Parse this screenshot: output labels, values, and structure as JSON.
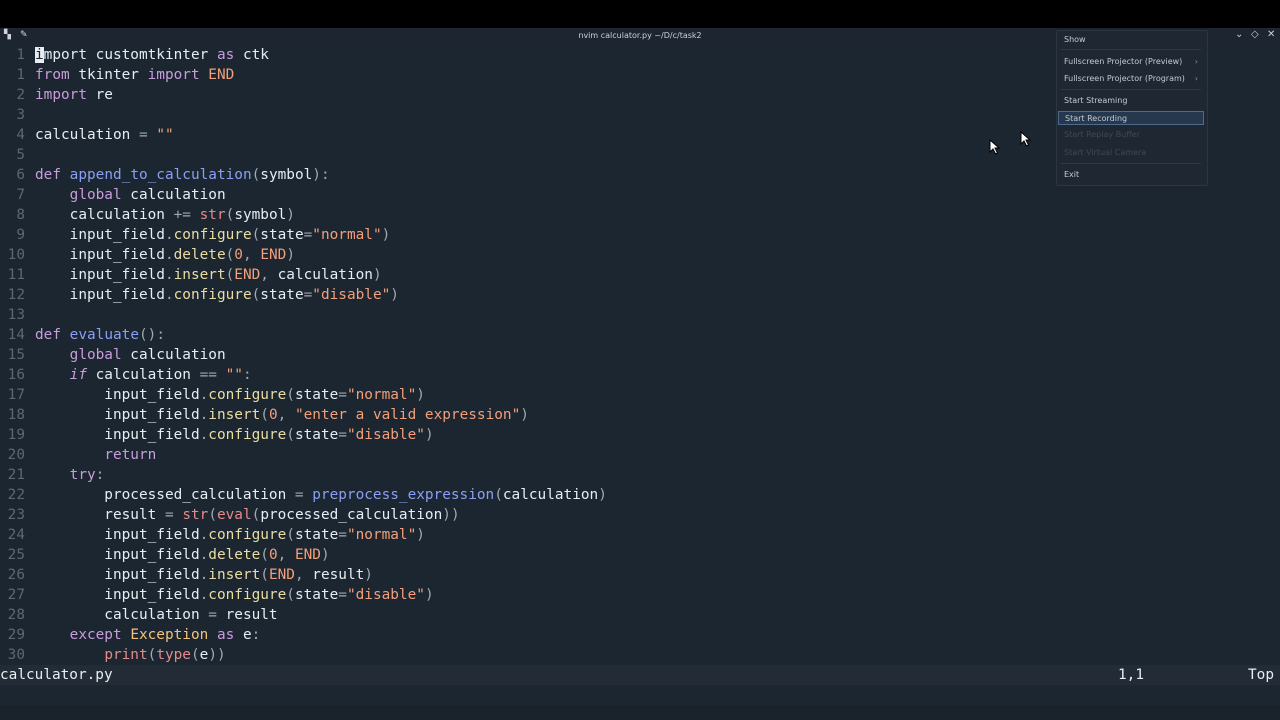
{
  "window": {
    "title": "nvim calculator.py ~/D/c/task2",
    "app_icon": "nvim-icon",
    "pin_icon": "pin-icon",
    "buttons": {
      "minimize": "⌄",
      "maximize": "◇",
      "close": "✕"
    }
  },
  "editor": {
    "lines": [
      {
        "ln": "1",
        "code": "import customtkinter as ctk"
      },
      {
        "ln": "1",
        "code": "from tkinter import END"
      },
      {
        "ln": "2",
        "code": "import re"
      },
      {
        "ln": "3",
        "code": ""
      },
      {
        "ln": "4",
        "code": "calculation = \"\""
      },
      {
        "ln": "5",
        "code": ""
      },
      {
        "ln": "6",
        "code": "def append_to_calculation(symbol):"
      },
      {
        "ln": "7",
        "code": "    global calculation"
      },
      {
        "ln": "8",
        "code": "    calculation += str(symbol)"
      },
      {
        "ln": "9",
        "code": "    input_field.configure(state=\"normal\")"
      },
      {
        "ln": "10",
        "code": "    input_field.delete(0, END)"
      },
      {
        "ln": "11",
        "code": "    input_field.insert(END, calculation)"
      },
      {
        "ln": "12",
        "code": "    input_field.configure(state=\"disable\")"
      },
      {
        "ln": "13",
        "code": ""
      },
      {
        "ln": "14",
        "code": "def evaluate():"
      },
      {
        "ln": "15",
        "code": "    global calculation"
      },
      {
        "ln": "16",
        "code": "    if calculation == \"\":"
      },
      {
        "ln": "17",
        "code": "        input_field.configure(state=\"normal\")"
      },
      {
        "ln": "18",
        "code": "        input_field.insert(0, \"enter a valid expression\")"
      },
      {
        "ln": "19",
        "code": "        input_field.configure(state=\"disable\")"
      },
      {
        "ln": "20",
        "code": "        return"
      },
      {
        "ln": "21",
        "code": "    try:"
      },
      {
        "ln": "22",
        "code": "        processed_calculation = preprocess_expression(calculation)"
      },
      {
        "ln": "23",
        "code": "        result = str(eval(processed_calculation))"
      },
      {
        "ln": "24",
        "code": "        input_field.configure(state=\"normal\")"
      },
      {
        "ln": "25",
        "code": "        input_field.delete(0, END)"
      },
      {
        "ln": "26",
        "code": "        input_field.insert(END, result)"
      },
      {
        "ln": "27",
        "code": "        input_field.configure(state=\"disable\")"
      },
      {
        "ln": "28",
        "code": "        calculation = result"
      },
      {
        "ln": "29",
        "code": "    except Exception as e:"
      },
      {
        "ln": "30",
        "code": "        print(type(e))"
      }
    ]
  },
  "statusline": {
    "filename": "calculator.py",
    "position": "1,1",
    "scroll": "Top"
  },
  "context_menu": {
    "items": [
      {
        "label": "Show",
        "enabled": true,
        "submenu": false
      },
      {
        "label": "Fullscreen Projector (Preview)",
        "enabled": true,
        "submenu": true
      },
      {
        "label": "Fullscreen Projector (Program)",
        "enabled": true,
        "submenu": true
      },
      {
        "label": "Start Streaming",
        "enabled": true,
        "submenu": false
      },
      {
        "label": "Start Recording",
        "enabled": true,
        "submenu": false,
        "highlighted": true
      },
      {
        "label": "Start Replay Buffer",
        "enabled": false,
        "submenu": false
      },
      {
        "label": "Start Virtual Camera",
        "enabled": false,
        "submenu": false
      },
      {
        "label": "Exit",
        "enabled": true,
        "submenu": false
      }
    ]
  },
  "colors": {
    "background": "#1c2631",
    "keyword": "#c89ddc",
    "function": "#8a9ff3",
    "string": "#f29f7a",
    "highlight": "#26384d"
  }
}
